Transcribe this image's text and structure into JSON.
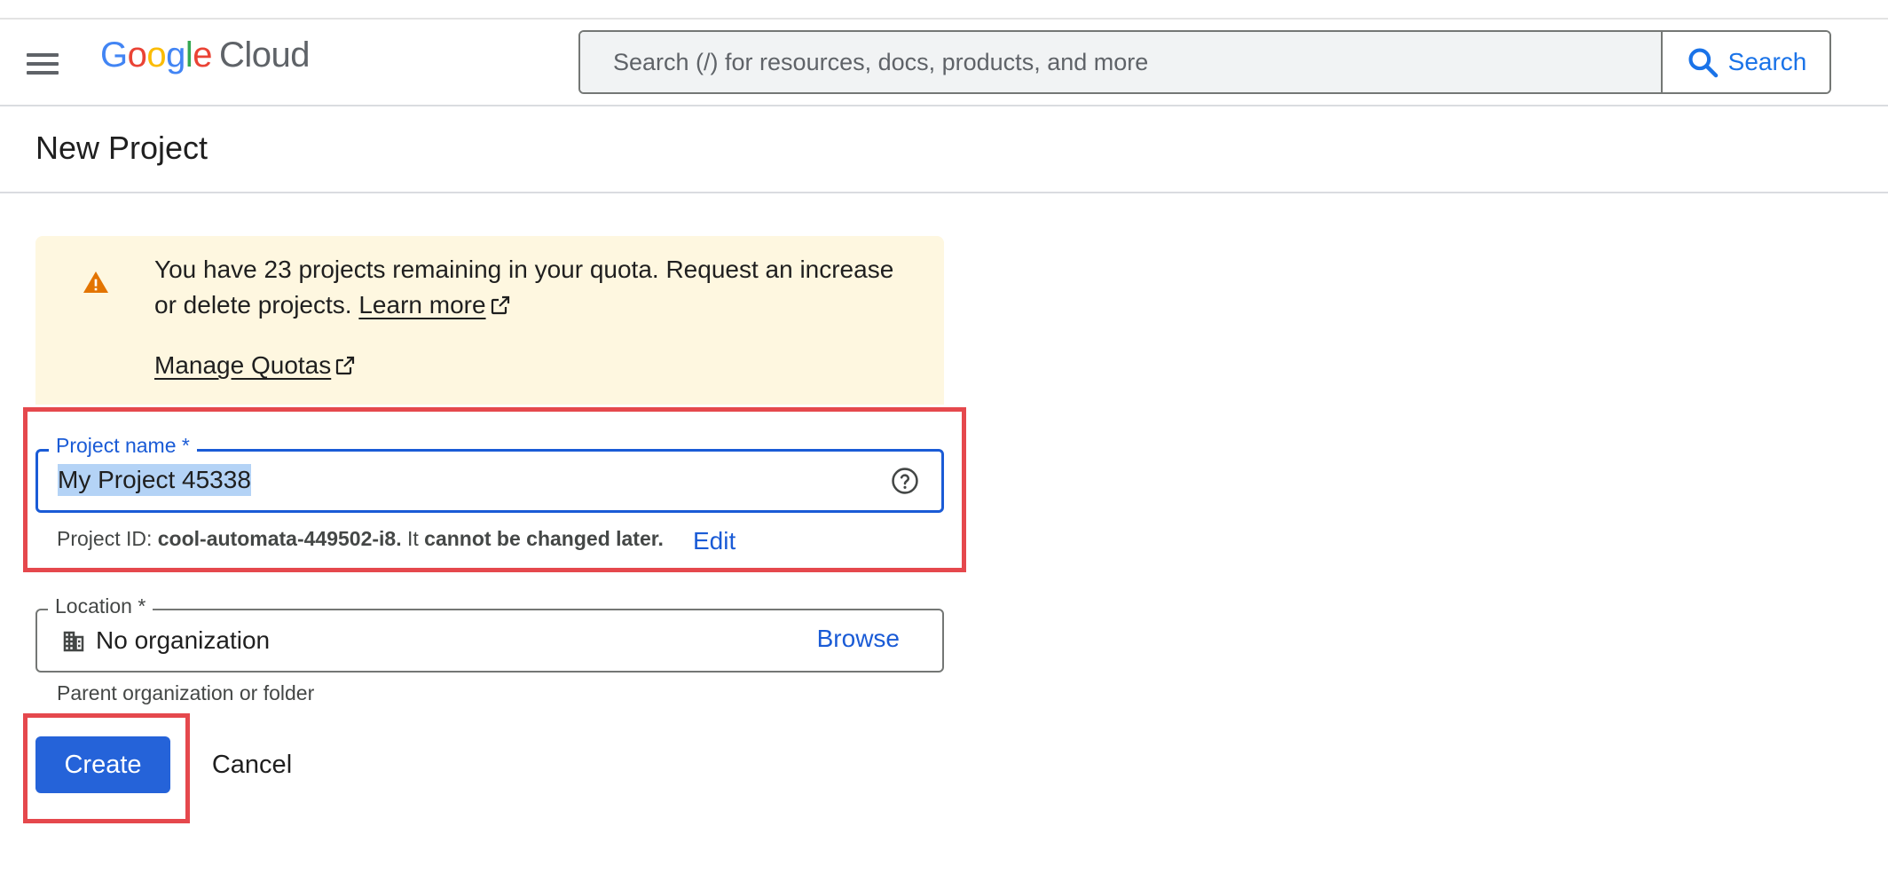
{
  "header": {
    "logo_letters": [
      "G",
      "o",
      "o",
      "g",
      "l",
      "e"
    ],
    "logo_product": "Cloud",
    "search_placeholder": "Search (/) for resources, docs, products, and more",
    "search_button_label": "Search"
  },
  "page": {
    "title": "New Project"
  },
  "quota_warning": {
    "message_part1": "You have 23 projects remaining in your quota. Request an increase or delete projects.",
    "learn_more_label": "Learn more",
    "manage_quotas_label": "Manage Quotas",
    "color": "#fef7e0",
    "icon": "warning-triangle-icon"
  },
  "project_name_field": {
    "label": "Project name *",
    "value": "My Project 45338",
    "selected": true
  },
  "project_id": {
    "prefix": "Project ID:",
    "id": "cool-automata-449502-i8.",
    "middle": "It",
    "suffix": "cannot be changed later.",
    "edit_label": "Edit"
  },
  "location_field": {
    "label": "Location *",
    "value": "No organization",
    "browse_label": "Browse",
    "hint": "Parent organization or folder"
  },
  "actions": {
    "create_label": "Create",
    "cancel_label": "Cancel"
  },
  "colors": {
    "accent": "#1a5bd6",
    "primary_button": "#2563d9",
    "highlight_annotation": "#e5484d",
    "warning": "#e37400"
  }
}
